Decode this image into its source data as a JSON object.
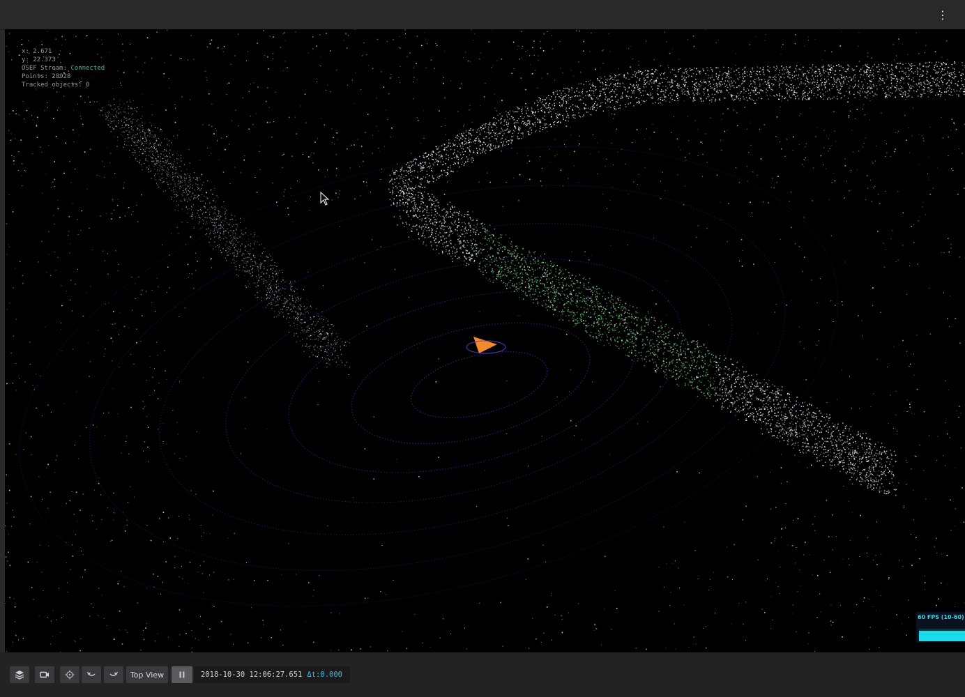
{
  "topbar": {
    "menu_icon": "kebab-menu-icon",
    "menu_glyph": "⋮"
  },
  "viewport": {
    "info": {
      "x_line": "x: 2.671",
      "y_line": "y: 22.373",
      "stream_label": "OSEF Stream:",
      "stream_status": "Connected",
      "points_line": "Points: 28928",
      "tracked_line": "Tracked objects: 0"
    },
    "fps": {
      "label": "60 FPS (10-60)",
      "level": 1.0
    },
    "colors": {
      "background": "#000000",
      "points": "#ffffff",
      "ground_rings": "#3a3cd0",
      "wall_highlight": "#6fe07a",
      "ego_marker": "#f28a2c",
      "connected": "#3cbf8c",
      "fps": "#19dbea"
    }
  },
  "toolbar": {
    "buttons": [
      {
        "name": "layers-button",
        "icon": "layers-icon"
      },
      {
        "name": "camera-button",
        "icon": "video-camera-icon"
      },
      {
        "name": "recenter-button",
        "icon": "crosshair-icon"
      },
      {
        "name": "rotate-left-button",
        "icon": "rotate-left-icon"
      },
      {
        "name": "rotate-right-button",
        "icon": "rotate-right-icon"
      }
    ],
    "top_view_label": "Top View",
    "pause_icon": "pause-icon",
    "timestamp": "2018-10-30 12:06:27.651",
    "delta": "Δt:0.000"
  }
}
